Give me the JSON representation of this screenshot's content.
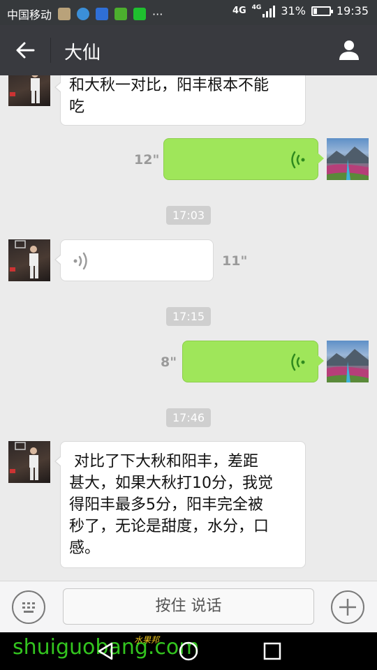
{
  "status_bar": {
    "carrier": "中国移动",
    "more": "···",
    "network_4g": "4G",
    "network_4g_small": "4G",
    "battery_percent": "31%",
    "battery_level": 0.31,
    "time": "19:35"
  },
  "title_bar": {
    "title": "大仙",
    "back_icon": "arrow-left-icon",
    "profile_icon": "person-icon"
  },
  "messages": [
    {
      "type": "text",
      "direction": "in",
      "text_lines": [
        "和大秋一对比，阳丰根本不能",
        "吃"
      ]
    },
    {
      "type": "voice",
      "direction": "out",
      "duration": "12\""
    },
    {
      "type": "time",
      "text": "17:03"
    },
    {
      "type": "voice",
      "direction": "in",
      "duration": "11\""
    },
    {
      "type": "time",
      "text": "17:15"
    },
    {
      "type": "voice",
      "direction": "out",
      "duration": "8\""
    },
    {
      "type": "time",
      "text": "17:46"
    },
    {
      "type": "text",
      "direction": "in",
      "text_lines": [
        " 对比了下大秋和阳丰，差距",
        "甚大，如果大秋打10分，我觉",
        "得阳丰最多5分，阳丰完全被",
        "秒了，无论是甜度，水分，口",
        "感。"
      ]
    }
  ],
  "input_bar": {
    "hold_to_talk": "按住 说话",
    "keyboard_icon": "keyboard-icon",
    "plus_icon": "plus-icon"
  },
  "watermark": {
    "text": "shuiguobang.com",
    "cn_text": "水果邦"
  },
  "colors": {
    "status_bar": "#36393c",
    "title_bar": "#393a3f",
    "chat_bg": "#ebebeb",
    "outgoing_bubble": "#9fe65a",
    "incoming_bubble": "#ffffff"
  }
}
